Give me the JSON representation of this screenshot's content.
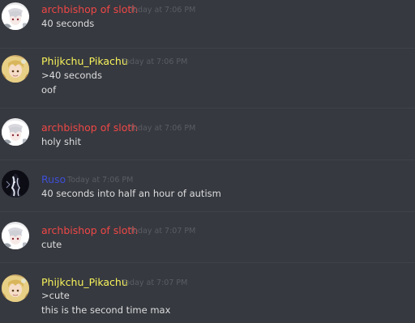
{
  "colors": {
    "background": "#36393f",
    "archbishop": "#f04747",
    "pikachu": "#f8f35c",
    "ruso": "#3e4fd6",
    "timestamp": "#5a5d63",
    "text": "#dcddde"
  },
  "messages": [
    {
      "username": "archbishop of sloth",
      "timestamp": "Today at 7:06 PM",
      "avatar_icon": "anime-girl-white-hair-avatar-icon",
      "lines": [
        "40 seconds"
      ]
    },
    {
      "username": "Phijkchu_Pikachu",
      "timestamp": "Today at 7:06 PM",
      "avatar_icon": "anime-girl-blonde-avatar-icon",
      "lines": [
        ">40 seconds",
        "oof"
      ]
    },
    {
      "username": "archbishop of sloth",
      "timestamp": "Today at 7:06 PM",
      "avatar_icon": "anime-girl-white-hair-avatar-icon",
      "lines": [
        "holy shit"
      ]
    },
    {
      "username": "Ruso",
      "timestamp": "Today at 7:06 PM",
      "avatar_icon": "dark-figure-avatar-icon",
      "lines": [
        "40 seconds into half an hour of autism"
      ]
    },
    {
      "username": "archbishop of sloth",
      "timestamp": "Today at 7:07 PM",
      "avatar_icon": "anime-girl-white-hair-avatar-icon",
      "lines": [
        "cute"
      ]
    },
    {
      "username": "Phijkchu_Pikachu",
      "timestamp": "Today at 7:07 PM",
      "avatar_icon": "anime-girl-blonde-avatar-icon",
      "lines": [
        ">cute",
        "this is the second time max"
      ]
    }
  ]
}
